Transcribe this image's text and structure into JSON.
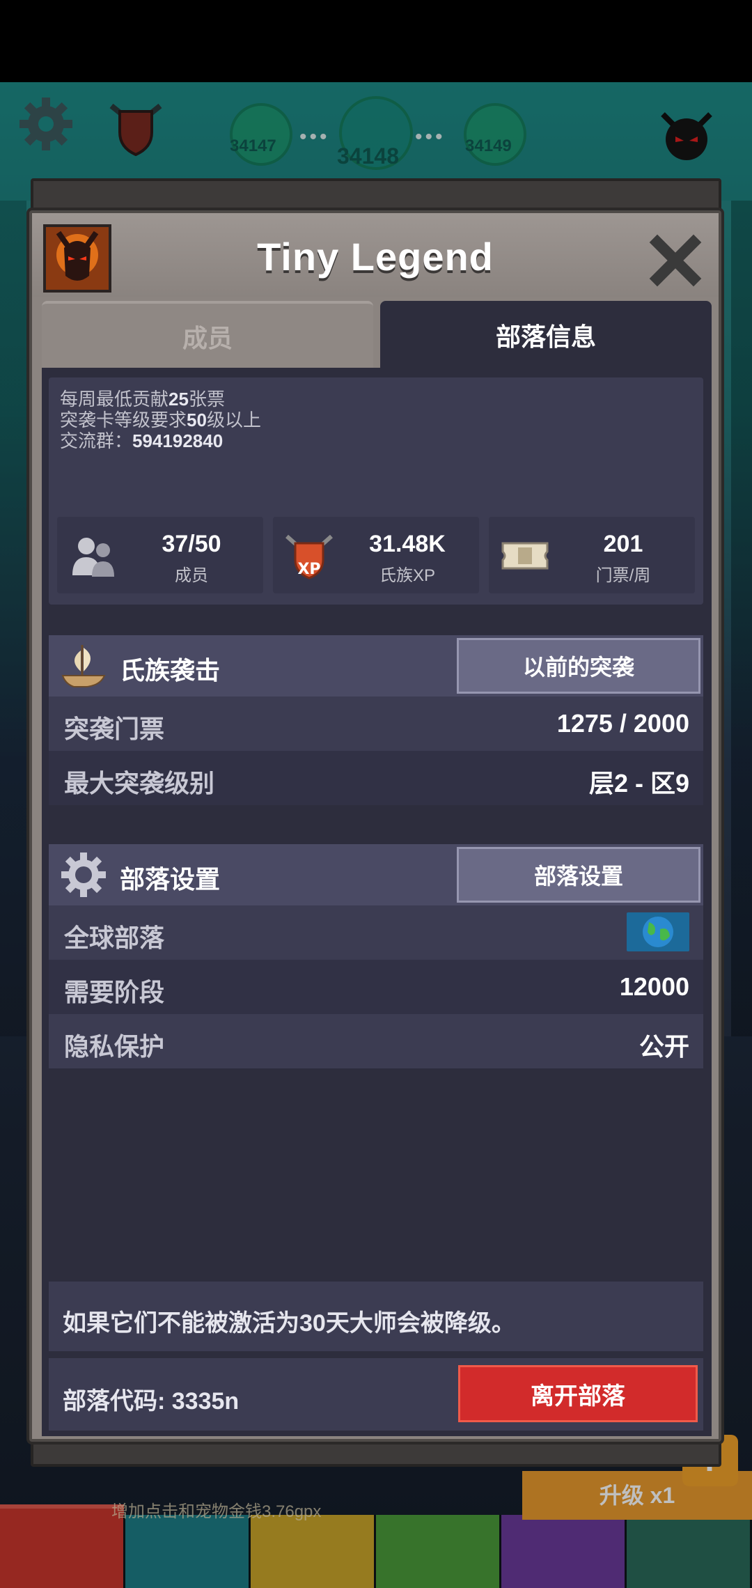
{
  "background": {
    "stage_prev_num": "34147",
    "stage_current_num": "34148",
    "stage_next_num": "34149",
    "upgrade_label": "升级 x1",
    "bg_text": "增加点击和宠物金钱3.76gpx",
    "help_label": "?"
  },
  "dialog": {
    "title": "Tiny Legend",
    "tabs": [
      {
        "label": "成员",
        "active": false
      },
      {
        "label": "部落信息",
        "active": true
      }
    ],
    "description": {
      "line1_prefix": "每周最低贡献",
      "line1_bold": "25",
      "line1_suffix": "张票",
      "line2_prefix": "突袭卡等级要求",
      "line2_bold": "50",
      "line2_suffix": "级以上",
      "line3_prefix": "交流群：",
      "line3_bold": "594192840"
    },
    "stats": [
      {
        "value": "37/50",
        "label": "成员",
        "icon": "members-icon"
      },
      {
        "value": "31.48K",
        "label": "氏族XP",
        "icon": "clan-xp-icon"
      },
      {
        "value": "201",
        "label": "门票/周",
        "icon": "ticket-icon"
      }
    ],
    "raid_section": {
      "title": "氏族袭击",
      "button": "以前的突袭",
      "rows": [
        {
          "key": "突袭门票",
          "value": "1275 / 2000"
        },
        {
          "key": "最大突袭级别",
          "value": "层2 - 区9"
        }
      ]
    },
    "settings_section": {
      "title": "部落设置",
      "button": "部落设置",
      "rows": [
        {
          "key": "全球部落",
          "value_icon": "globe-icon"
        },
        {
          "key": "需要阶段",
          "value": "12000"
        },
        {
          "key": "隐私保护",
          "value": "公开"
        }
      ]
    },
    "note": "如果它们不能被激活为30天大师会被降级。",
    "clan_code": "部落代码: 3335n",
    "leave_button": "离开部落"
  },
  "colors": {
    "panel_dark": "#2d2d3d",
    "leave_red": "#d22b2b",
    "frame_grey": "#8b8480"
  }
}
